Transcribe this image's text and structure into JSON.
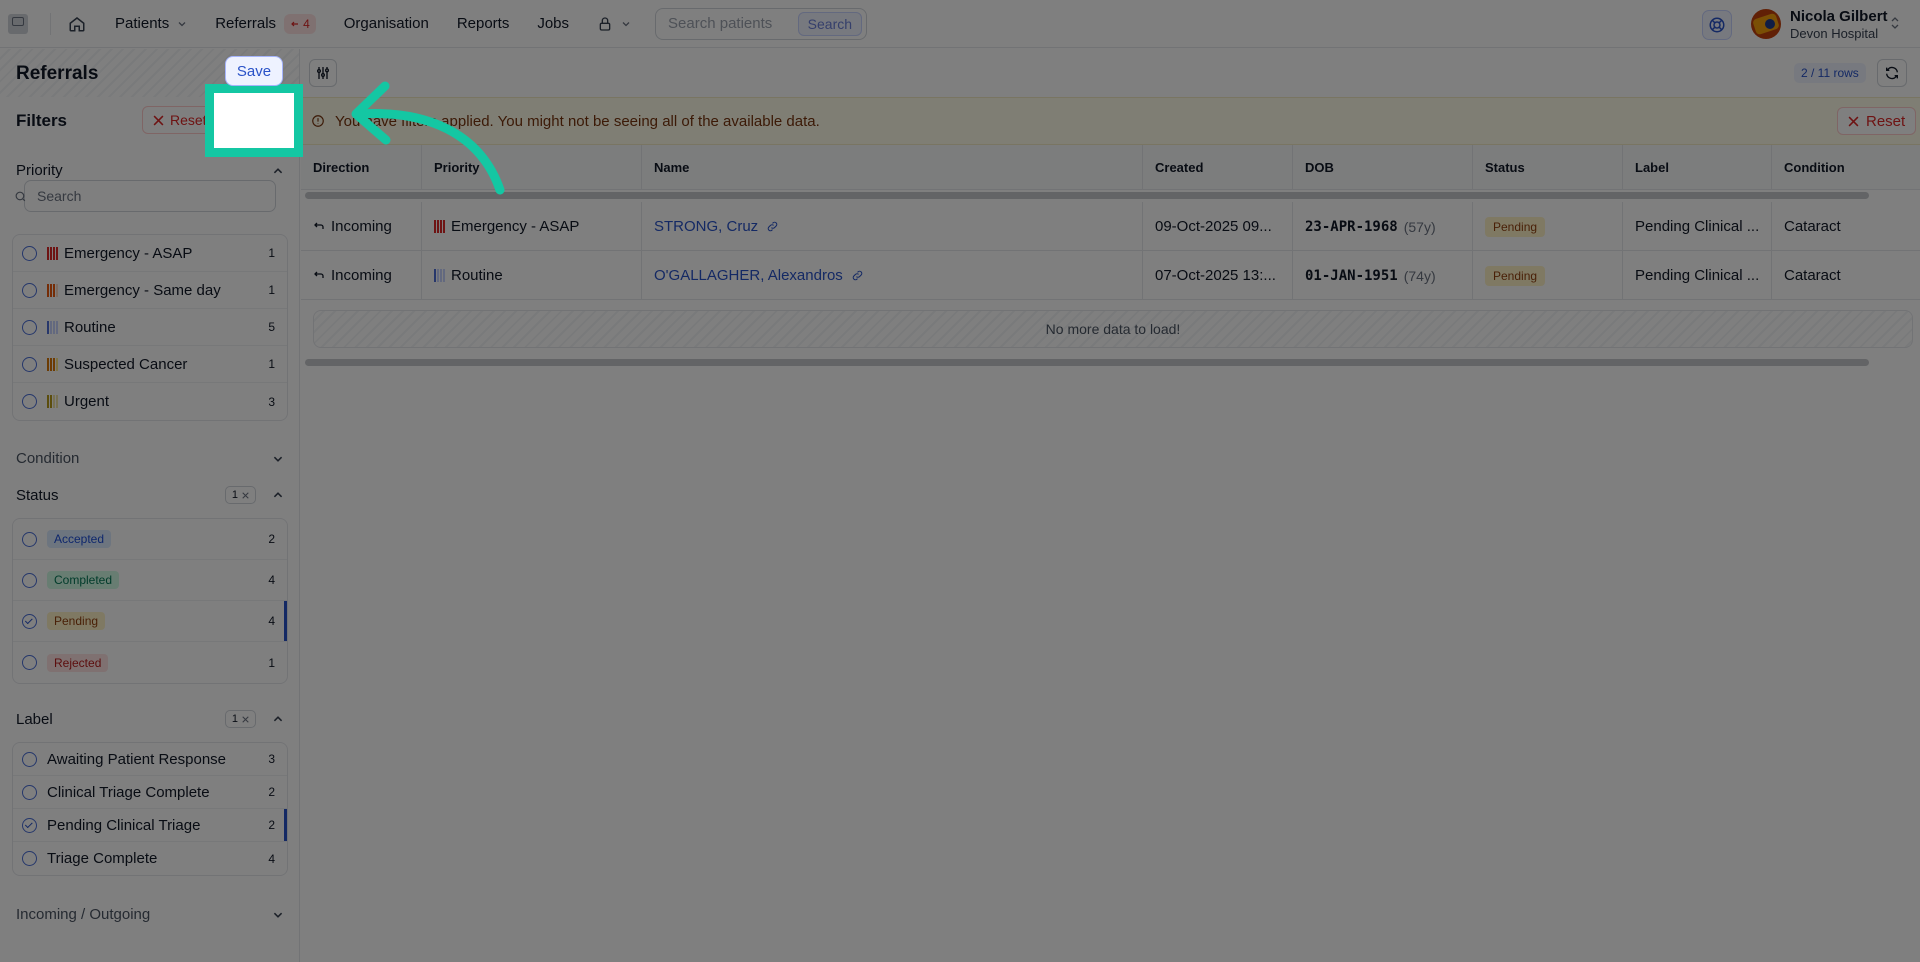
{
  "nav": {
    "items": [
      {
        "label": "Patients",
        "has_menu": true
      },
      {
        "label": "Referrals",
        "badge": "4"
      },
      {
        "label": "Organisation"
      },
      {
        "label": "Reports"
      },
      {
        "label": "Jobs"
      }
    ],
    "search_placeholder": "Search patients",
    "search_button": "Search",
    "user_name": "Nicola Gilbert",
    "user_org": "Devon Hospital"
  },
  "sidebar": {
    "title": "Referrals",
    "filters_label": "Filters",
    "reset_label": "Reset",
    "save_label": "Save",
    "priority": {
      "title": "Priority",
      "search_placeholder": "Search",
      "options": [
        {
          "label": "Emergency - ASAP",
          "count": "1",
          "color": "#dc2626"
        },
        {
          "label": "Emergency - Same day",
          "count": "1",
          "color": "#ea580c"
        },
        {
          "label": "Routine",
          "count": "5",
          "color": "#4f6fd6"
        },
        {
          "label": "Suspected Cancer",
          "count": "1",
          "color": "#d97706"
        },
        {
          "label": "Urgent",
          "count": "3",
          "color": "#b79a1a"
        }
      ]
    },
    "condition": {
      "title": "Condition"
    },
    "status": {
      "title": "Status",
      "active_count": "1",
      "options": [
        {
          "label": "Accepted",
          "count": "2",
          "bg": "#dbeafe",
          "fg": "#1d4ed8",
          "selected": false
        },
        {
          "label": "Completed",
          "count": "4",
          "bg": "#d1fae5",
          "fg": "#047857",
          "selected": false
        },
        {
          "label": "Pending",
          "count": "4",
          "bg": "#fef3c7",
          "fg": "#92400e",
          "selected": true
        },
        {
          "label": "Rejected",
          "count": "1",
          "bg": "#fee2e2",
          "fg": "#b91c1c",
          "selected": false
        }
      ]
    },
    "label": {
      "title": "Label",
      "active_count": "1",
      "options": [
        {
          "label": "Awaiting Patient Response",
          "count": "3",
          "selected": false
        },
        {
          "label": "Clinical Triage Complete",
          "count": "2",
          "selected": false
        },
        {
          "label": "Pending Clinical Triage",
          "count": "2",
          "selected": true
        },
        {
          "label": "Triage Complete",
          "count": "4",
          "selected": false
        }
      ]
    },
    "direction": {
      "title": "Incoming / Outgoing"
    }
  },
  "main": {
    "rows_count": "2 / 11 rows",
    "banner_text": "You have filters applied. You might not be seeing all of the available data.",
    "banner_reset": "Reset",
    "columns": [
      "Direction",
      "Priority",
      "Name",
      "Created",
      "DOB",
      "Status",
      "Label",
      "Condition"
    ],
    "rows": [
      {
        "direction": "Incoming",
        "priority": "Emergency - ASAP",
        "priority_color": "#dc2626",
        "name": "STRONG, Cruz",
        "created": "09-Oct-2025 09...",
        "dob": "23-APR-1968",
        "age": "(57y)",
        "status": "Pending",
        "label": "Pending Clinical ...",
        "condition": "Cataract"
      },
      {
        "direction": "Incoming",
        "priority": "Routine",
        "priority_color": "#4f6fd6",
        "name": "O'GALLAGHER, Alexandros",
        "created": "07-Oct-2025 13:...",
        "dob": "01-JAN-1951",
        "age": "(74y)",
        "status": "Pending",
        "label": "Pending Clinical ...",
        "condition": "Cataract"
      }
    ],
    "no_more": "No more data to load!"
  },
  "overlay": {
    "accent": "#14c7a3"
  }
}
